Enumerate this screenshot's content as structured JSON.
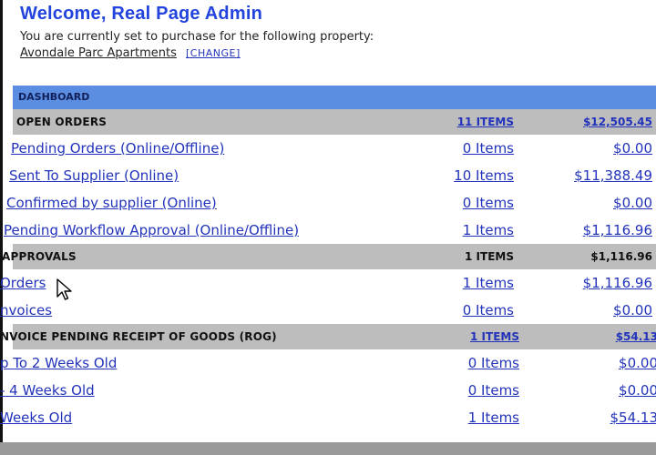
{
  "header": {
    "welcome": "Welcome, Real Page Admin",
    "subtitle": "You are currently set to purchase for the following property:",
    "property": "Avondale Parc Apartments",
    "change_label": "[CHANGE]"
  },
  "dashboard": {
    "title": "DASHBOARD",
    "open_orders": {
      "label": "OPEN ORDERS",
      "count": "11 ITEMS",
      "amount": "$12,505.45",
      "rows": [
        {
          "label": "Pending Orders (Online/Offline)",
          "count": "0 Items",
          "amount": "$0.00"
        },
        {
          "label": "Sent To Supplier (Online)",
          "count": "10 Items",
          "amount": "$11,388.49"
        },
        {
          "label": "Confirmed by supplier (Online)",
          "count": "0 Items",
          "amount": "$0.00"
        },
        {
          "label": "Pending Workflow Approval (Online/Offline)",
          "count": "1 Items",
          "amount": "$1,116.96"
        }
      ]
    },
    "approvals": {
      "label": "APPROVALS",
      "count": "1 ITEMS",
      "amount": "$1,116.96",
      "rows": [
        {
          "label": "Orders",
          "count": "1 Items",
          "amount": "$1,116.96"
        },
        {
          "label": "nvoices",
          "count": "0 Items",
          "amount": "$0.00"
        }
      ]
    },
    "rog": {
      "label": "NVOICE PENDING RECEIPT OF GOODS (ROG)",
      "count": "1 ITEMS",
      "amount": "$54.13",
      "rows": [
        {
          "label": "p To 2 Weeks Old",
          "count": "0 Items",
          "amount": "$0.00"
        },
        {
          "label": "- 4 Weeks Old",
          "count": "0 Items",
          "amount": "$0.00"
        },
        {
          "label": " Weeks Old",
          "count": "1 Items",
          "amount": "$54.13"
        }
      ]
    }
  },
  "colors": {
    "accent_blue": "#2244dd",
    "dashboard_header": "#5b8de0",
    "section_gray": "#bdbdbd",
    "link": "#2233bb"
  },
  "icons": [
    "mouse-pointer-icon"
  ]
}
